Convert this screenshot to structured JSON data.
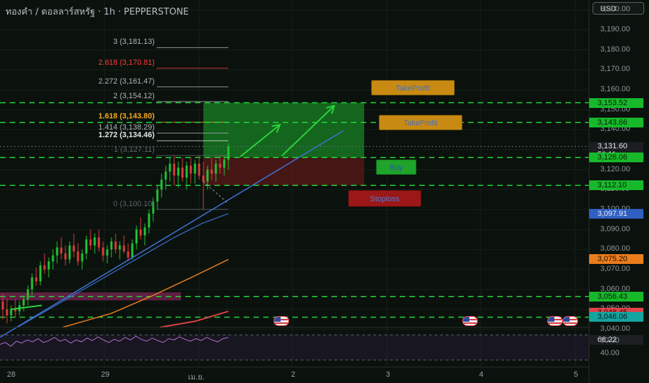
{
  "title": "ทองคำ / ดอลลาร์สหรัฐ · 1h · PEPPERSTONE",
  "currency_button": "USD",
  "colors": {
    "background": "#0b120d",
    "bull": "#22c534",
    "bear": "#e13b3b",
    "fib": "#b0b4bb",
    "fib_red": "#ff3b3b",
    "fib_orange": "#f5a623",
    "level_line": "#22d63a",
    "trend_line": "#3f74d8",
    "sma_blue": "#3a6fd0",
    "sma_orange": "#ec7d1c",
    "sma_red": "#e0424a"
  },
  "y_axis": {
    "min": 3041,
    "max": 3205,
    "ticks": [
      "3,200.00",
      "3,190.00",
      "3,180.00",
      "3,170.00",
      "3,160.00",
      "3,150.00",
      "3,140.00",
      "3,130.00",
      "3,120.00",
      "3,110.00",
      "3,100.00",
      "3,090.00",
      "3,080.00",
      "3,070.00",
      "3,060.00",
      "3,050.00",
      "3,040.00"
    ]
  },
  "x_axis": {
    "labels": [
      "28",
      "29",
      "เม.ย.",
      "2",
      "3",
      "4",
      "5"
    ]
  },
  "fib_levels": [
    {
      "label": "3 (3,181.13)",
      "price": 3181.13,
      "tone": "fib"
    },
    {
      "label": "2.618 (3,170.81)",
      "price": 3170.81,
      "tone": "fib_red"
    },
    {
      "label": "2.272 (3,161.47)",
      "price": 3161.47,
      "tone": "fib"
    },
    {
      "label": "2 (3,154.12)",
      "price": 3154.12,
      "tone": "fib"
    },
    {
      "label": "1.618 (3,143.80)",
      "price": 3143.8,
      "tone": "fib_orange"
    },
    {
      "label": "1.414 (3,138.29)",
      "price": 3138.29,
      "tone": "fib"
    },
    {
      "label": "1.272 (3,134.46)",
      "price": 3134.46,
      "tone": "fib_bold"
    },
    {
      "label": "1 (3,127.11)",
      "price": 3127.11,
      "tone": "fib_dim"
    },
    {
      "label": "0 (3,100.10)",
      "price": 3100.1,
      "tone": "fib_dim"
    }
  ],
  "horizontal_levels": [
    3153.52,
    3143.66,
    3126.06,
    3112.1,
    3056.43,
    3046.06
  ],
  "price_tags": [
    {
      "text": "3,153.52",
      "price": 3153.52,
      "style": "green"
    },
    {
      "text": "3,143.66",
      "price": 3143.66,
      "style": "green"
    },
    {
      "text": "3,131.60",
      "sub": "50:11",
      "price": 3131.6,
      "style": "dark"
    },
    {
      "text": "3,126.06",
      "price": 3126.06,
      "style": "green"
    },
    {
      "text": "3,112.10",
      "price": 3112.1,
      "style": "green"
    },
    {
      "text": "3,097.91",
      "price": 3097.91,
      "style": "blue"
    },
    {
      "text": "3,075.20",
      "price": 3075.2,
      "style": "orange"
    },
    {
      "text": "3,056.43",
      "price": 3056.43,
      "style": "green"
    },
    {
      "text": "3,048.45",
      "price": 3048.45,
      "style": "red"
    },
    {
      "text": "3,046.06",
      "price": 3046.06,
      "style": "teal"
    }
  ],
  "annotations": {
    "take_profit_1": "TakeProfit",
    "take_profit_2": "TakeProfit",
    "buy": "Buy",
    "stop_loss": "Stoploss"
  },
  "rsi": {
    "value": 66.22,
    "value_label": "66.22",
    "ticks": [
      "60.00",
      "40.00"
    ],
    "min": 20,
    "max": 80
  },
  "candles": [
    [
      3054,
      3058,
      3045,
      3050
    ],
    [
      3050,
      3055,
      3043,
      3047
    ],
    [
      3047,
      3052,
      3044,
      3050
    ],
    [
      3050,
      3055,
      3046,
      3049
    ],
    [
      3049,
      3054,
      3047,
      3052
    ],
    [
      3052,
      3057,
      3049,
      3055
    ],
    [
      3055,
      3062,
      3052,
      3060
    ],
    [
      3060,
      3068,
      3057,
      3066
    ],
    [
      3066,
      3071,
      3062,
      3064
    ],
    [
      3064,
      3074,
      3062,
      3072
    ],
    [
      3072,
      3078,
      3068,
      3070
    ],
    [
      3070,
      3076,
      3066,
      3074
    ],
    [
      3074,
      3080,
      3070,
      3077
    ],
    [
      3077,
      3084,
      3073,
      3081
    ],
    [
      3081,
      3086,
      3075,
      3078
    ],
    [
      3078,
      3082,
      3072,
      3075
    ],
    [
      3075,
      3084,
      3073,
      3082
    ],
    [
      3082,
      3088,
      3076,
      3079
    ],
    [
      3079,
      3083,
      3072,
      3074
    ],
    [
      3074,
      3080,
      3070,
      3078
    ],
    [
      3078,
      3087,
      3075,
      3085
    ],
    [
      3085,
      3090,
      3080,
      3082
    ],
    [
      3082,
      3088,
      3078,
      3086
    ],
    [
      3086,
      3090,
      3079,
      3081
    ],
    [
      3081,
      3084,
      3074,
      3077
    ],
    [
      3077,
      3082,
      3073,
      3080
    ],
    [
      3080,
      3086,
      3076,
      3084
    ],
    [
      3084,
      3088,
      3078,
      3080
    ],
    [
      3080,
      3084,
      3075,
      3082
    ],
    [
      3082,
      3087,
      3078,
      3079
    ],
    [
      3079,
      3083,
      3074,
      3076
    ],
    [
      3076,
      3085,
      3075,
      3083
    ],
    [
      3083,
      3092,
      3080,
      3090
    ],
    [
      3090,
      3096,
      3085,
      3087
    ],
    [
      3087,
      3093,
      3082,
      3091
    ],
    [
      3091,
      3100,
      3088,
      3098
    ],
    [
      3098,
      3106,
      3094,
      3104
    ],
    [
      3104,
      3112,
      3100,
      3110
    ],
    [
      3110,
      3118,
      3106,
      3115
    ],
    [
      3115,
      3122,
      3110,
      3119
    ],
    [
      3119,
      3126,
      3114,
      3123
    ],
    [
      3123,
      3127,
      3112,
      3117
    ],
    [
      3117,
      3124,
      3111,
      3121
    ],
    [
      3121,
      3126,
      3114,
      3116
    ],
    [
      3116,
      3124,
      3110,
      3122
    ],
    [
      3122,
      3126,
      3113,
      3118
    ],
    [
      3118,
      3125,
      3113,
      3123
    ],
    [
      3123,
      3127,
      3115,
      3117
    ],
    [
      3117,
      3124,
      3100,
      3114
    ],
    [
      3114,
      3122,
      3110,
      3120
    ],
    [
      3120,
      3126,
      3115,
      3118
    ],
    [
      3118,
      3125,
      3114,
      3123
    ],
    [
      3123,
      3127,
      3118,
      3121
    ],
    [
      3121,
      3127,
      3117,
      3125
    ],
    [
      3125,
      3133,
      3120,
      3131.6
    ]
  ]
}
